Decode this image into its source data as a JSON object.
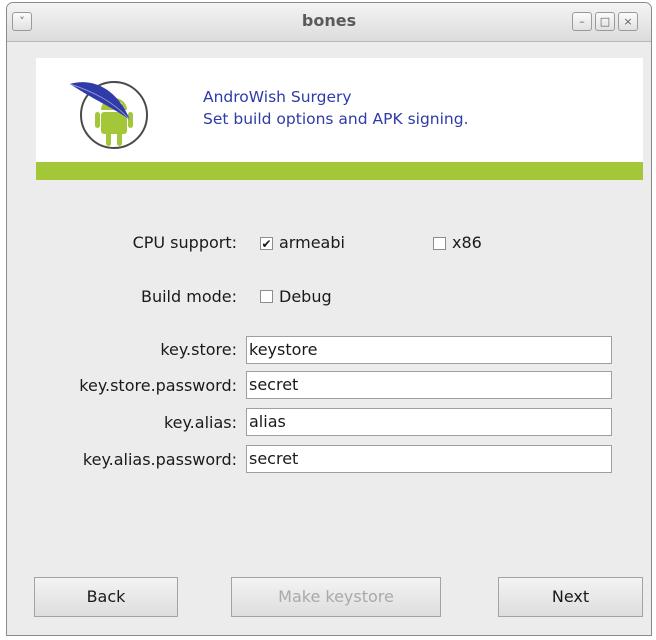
{
  "window": {
    "title": "bones",
    "menu_glyph": "˅",
    "minimize_glyph": "–",
    "maximize_glyph": "□",
    "close_glyph": "×"
  },
  "banner": {
    "line1": "AndroWish Surgery",
    "line2": "Set build options and APK signing.",
    "logo_icon": "androwish-feather-logo",
    "accent_color": "#a4c639",
    "text_color": "#2f3ba8"
  },
  "options": {
    "cpu_label": "CPU support:",
    "cpu_armeabi_label": "armeabi",
    "cpu_armeabi_checked": true,
    "cpu_x86_label": "x86",
    "cpu_x86_checked": false,
    "build_label": "Build mode:",
    "debug_label": "Debug",
    "debug_checked": false,
    "check_glyph": "✔"
  },
  "fields": {
    "key_store": {
      "label": "key.store:",
      "value": "keystore"
    },
    "key_store_password": {
      "label": "key.store.password:",
      "value": "secret"
    },
    "key_alias": {
      "label": "key.alias:",
      "value": "alias"
    },
    "key_alias_password": {
      "label": "key.alias.password:",
      "value": "secret"
    }
  },
  "buttons": {
    "back": "Back",
    "make_keystore": "Make keystore",
    "next": "Next"
  }
}
